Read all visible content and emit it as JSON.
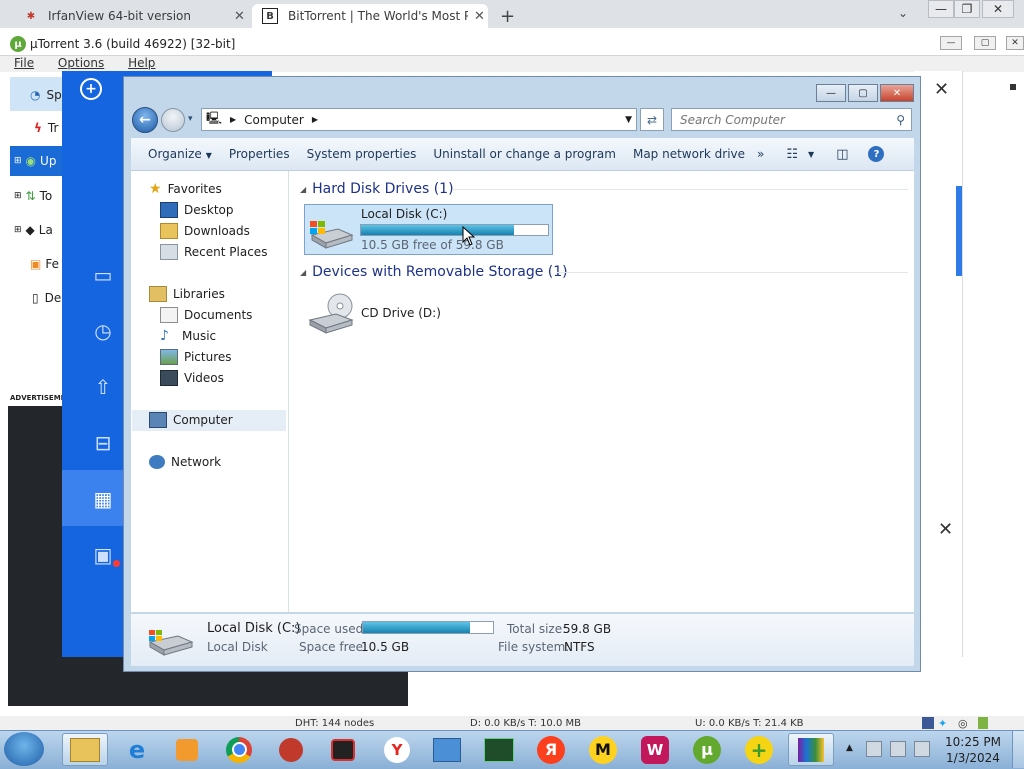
{
  "browser": {
    "tabs": [
      {
        "title": "IrfanView 64-bit version",
        "icon": "irfanview-icon",
        "active": false
      },
      {
        "title": "BitTorrent | The World's Most Popular",
        "icon": "bittorrent-b-icon",
        "active": true
      }
    ],
    "new_tab_glyph": "+",
    "tab_list_glyph": "⌄"
  },
  "utorrent": {
    "title": "µTorrent 3.6  (build 46922) [32-bit]",
    "menu": [
      "File",
      "Options",
      "Help"
    ],
    "sidebar_items": [
      "Sp",
      "Tr",
      "Up",
      "To",
      "La",
      "Fe",
      "De"
    ],
    "ad_label": "ADVERTISEMEN",
    "status": {
      "dht": "DHT: 144 nodes",
      "down": "D: 0.0 KB/s T: 10.0 MB",
      "up": "U: 0.0 KB/s T: 21.4 KB"
    }
  },
  "explorer": {
    "address_path": [
      "Computer"
    ],
    "search_placeholder": "Search Computer",
    "commands": [
      "Organize",
      "Properties",
      "System properties",
      "Uninstall or change a program",
      "Map network drive",
      "»"
    ],
    "nav": {
      "favorites_label": "Favorites",
      "favorites": [
        "Desktop",
        "Downloads",
        "Recent Places"
      ],
      "libraries_label": "Libraries",
      "libraries": [
        "Documents",
        "Music",
        "Pictures",
        "Videos"
      ],
      "computer_label": "Computer",
      "network_label": "Network"
    },
    "groups": [
      {
        "title": "Hard Disk Drives (1)"
      },
      {
        "title": "Devices with Removable Storage (1)"
      }
    ],
    "drive_c": {
      "name": "Local Disk (C:)",
      "free_text": "10.5 GB free of 59.8 GB",
      "used_fraction": 0.82
    },
    "drive_d": {
      "name": "CD Drive (D:)"
    },
    "details": {
      "name": "Local Disk (C:)",
      "type": "Local Disk",
      "space_used_label": "Space used:",
      "space_free_label": "Space free:",
      "space_free_value": "10.5 GB",
      "total_size_label": "Total size:",
      "total_size_value": "59.8 GB",
      "filesystem_label": "File system:",
      "filesystem_value": "NTFS",
      "used_fraction": 0.82
    }
  },
  "taskbar": {
    "clock_time": "10:25 PM",
    "clock_date": "1/3/2024",
    "apps": [
      "file-explorer-icon",
      "internet-explorer-icon",
      "media-player-icon",
      "chrome-icon",
      "spider-app-icon",
      "video-recorder-icon",
      "yandex-browser-icon",
      "control-panel-icon",
      "task-manager-icon",
      "yandex-icon",
      "hm-app-icon",
      "wondershare-icon",
      "utorrent-icon",
      "green-plus-icon",
      "winrar-icon"
    ],
    "glyphs": {
      "yandex_browser": "Y",
      "yandex": "Я",
      "hm": "M",
      "wondershare": "W",
      "utorrent": "µ"
    }
  }
}
